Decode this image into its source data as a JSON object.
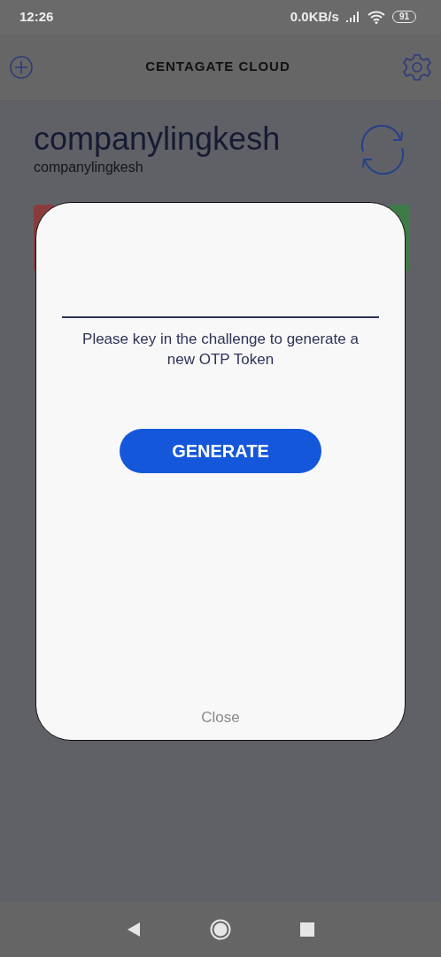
{
  "status_bar": {
    "time": "12:26",
    "network_speed": "0.0KB/s",
    "battery": "91"
  },
  "app_bar": {
    "logo": "CENTAGATE CLOUD"
  },
  "account": {
    "title": "companylingkesh",
    "subtitle": "companylingkesh"
  },
  "cards_behind": [
    {
      "color": "#8a3c3c"
    },
    {
      "color": "#3f7a49"
    }
  ],
  "dialog": {
    "message": "Please key in the challenge to generate a new OTP Token",
    "button": "GENERATE",
    "close": "Close"
  }
}
